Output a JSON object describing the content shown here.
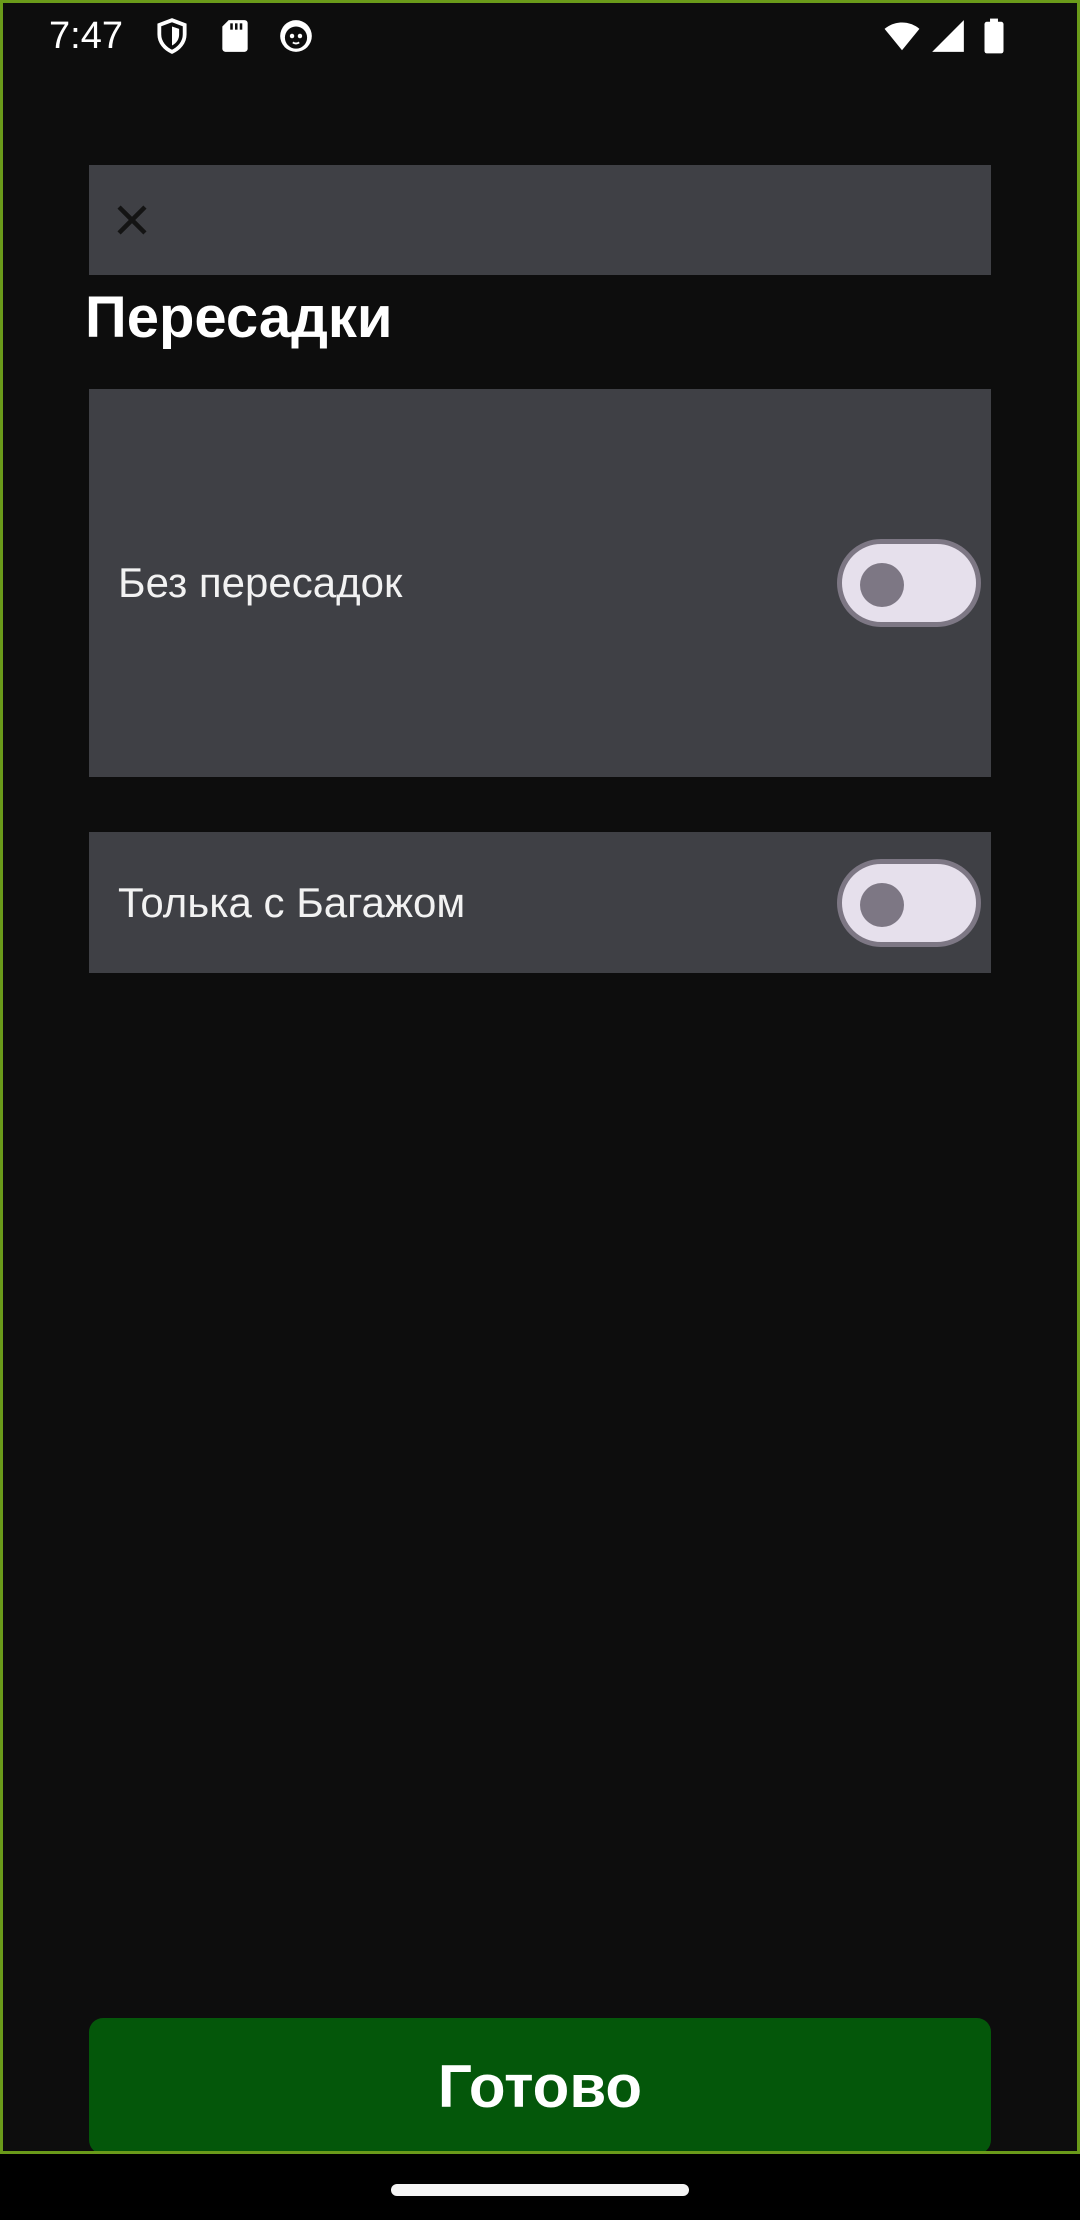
{
  "status_bar": {
    "time": "7:47",
    "left_icons": [
      "shield-icon",
      "sd-card-icon",
      "cat-face-icon"
    ],
    "right_icons": [
      "wifi-icon",
      "cell-signal-icon",
      "battery-icon"
    ]
  },
  "header": {
    "close_icon": "close-icon"
  },
  "page": {
    "title": "Пересадки"
  },
  "options": [
    {
      "label": "Без пересадок",
      "enabled": false
    },
    {
      "label": "Толька с Багажом",
      "enabled": false
    }
  ],
  "footer": {
    "done_label": "Готово"
  },
  "colors": {
    "background": "#0d0d0d",
    "card": "#3f4045",
    "toggle_track": "#e6e0ec",
    "toggle_outline": "#7d7784",
    "done_button": "#04570a",
    "frame_border": "#6a9a1a"
  }
}
